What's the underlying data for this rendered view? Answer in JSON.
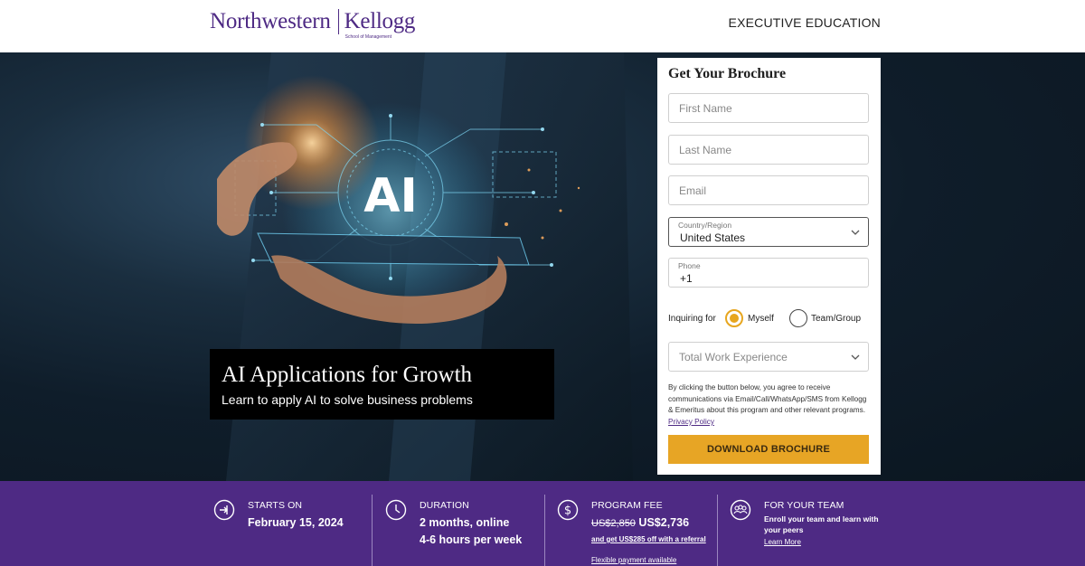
{
  "header": {
    "logo_primary": "Northwestern",
    "logo_secondary": "Kellogg",
    "logo_tagline": "School of Management",
    "nav_label": "EXECUTIVE EDUCATION"
  },
  "hero": {
    "title": "AI Applications for Growth",
    "subtitle": "Learn to apply AI to solve business problems",
    "image_text": "AI"
  },
  "form": {
    "title": "Get Your Brochure",
    "first_name_placeholder": "First Name",
    "last_name_placeholder": "Last Name",
    "email_placeholder": "Email",
    "country_label": "Country/Region",
    "country_value": "United States",
    "phone_label": "Phone",
    "phone_value": "+1",
    "inquiring_label": "Inquiring for",
    "option_myself": "Myself",
    "option_team": "Team/Group",
    "selected_option": "Myself",
    "experience_placeholder": "Total Work Experience",
    "consent_text": "By clicking the button below, you agree to receive communications via Email/Call/WhatsApp/SMS from Kellogg & Emeritus about this program and other relevant programs.",
    "privacy_link": "Privacy Policy",
    "submit_label": "DOWNLOAD BROCHURE"
  },
  "info": {
    "starts": {
      "heading": "STARTS ON",
      "value": "February 15, 2024",
      "icon": "calendar-arrow-icon"
    },
    "duration": {
      "heading": "DURATION",
      "line1": "2 months, online",
      "line2": "4-6 hours per week",
      "icon": "clock-icon"
    },
    "fee": {
      "heading": "PROGRAM FEE",
      "old_price": "US$2,850",
      "price": "US$2,736",
      "referral": "and get US$285 off with a referral",
      "flexible": "Flexible payment available",
      "icon": "dollar-icon"
    },
    "team": {
      "heading": "FOR YOUR TEAM",
      "description_line1": "Enroll your team and learn with",
      "description_line2": "your peers",
      "link": "Learn More",
      "icon": "team-icon"
    }
  },
  "colors": {
    "brand_purple": "#4e2a84",
    "accent_gold": "#e7a525",
    "hero_dark": "#0f1d2a"
  }
}
